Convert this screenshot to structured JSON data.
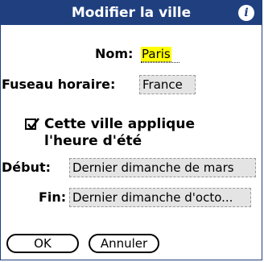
{
  "dialog": {
    "title": "Modifier la ville",
    "info_icon_glyph": "i"
  },
  "fields": {
    "name_label": "Nom:",
    "name_value": "Paris",
    "timezone_label": "Fuseau horaire:",
    "timezone_value": "France",
    "dst_checkbox_label_line1": "Cette ville applique",
    "dst_checkbox_label_line2": "l'heure d'été",
    "dst_checked": true,
    "start_label": "Début:",
    "start_value": "Dernier dimanche de mars",
    "end_label": "Fin:",
    "end_value": "Dernier dimanche d'octo..."
  },
  "buttons": {
    "ok_label": "OK",
    "cancel_label": "Annuler"
  },
  "colors": {
    "titlebar": "#1f3f7f",
    "name_highlight": "#ffff00",
    "selector_bg": "#e4e4e4"
  }
}
